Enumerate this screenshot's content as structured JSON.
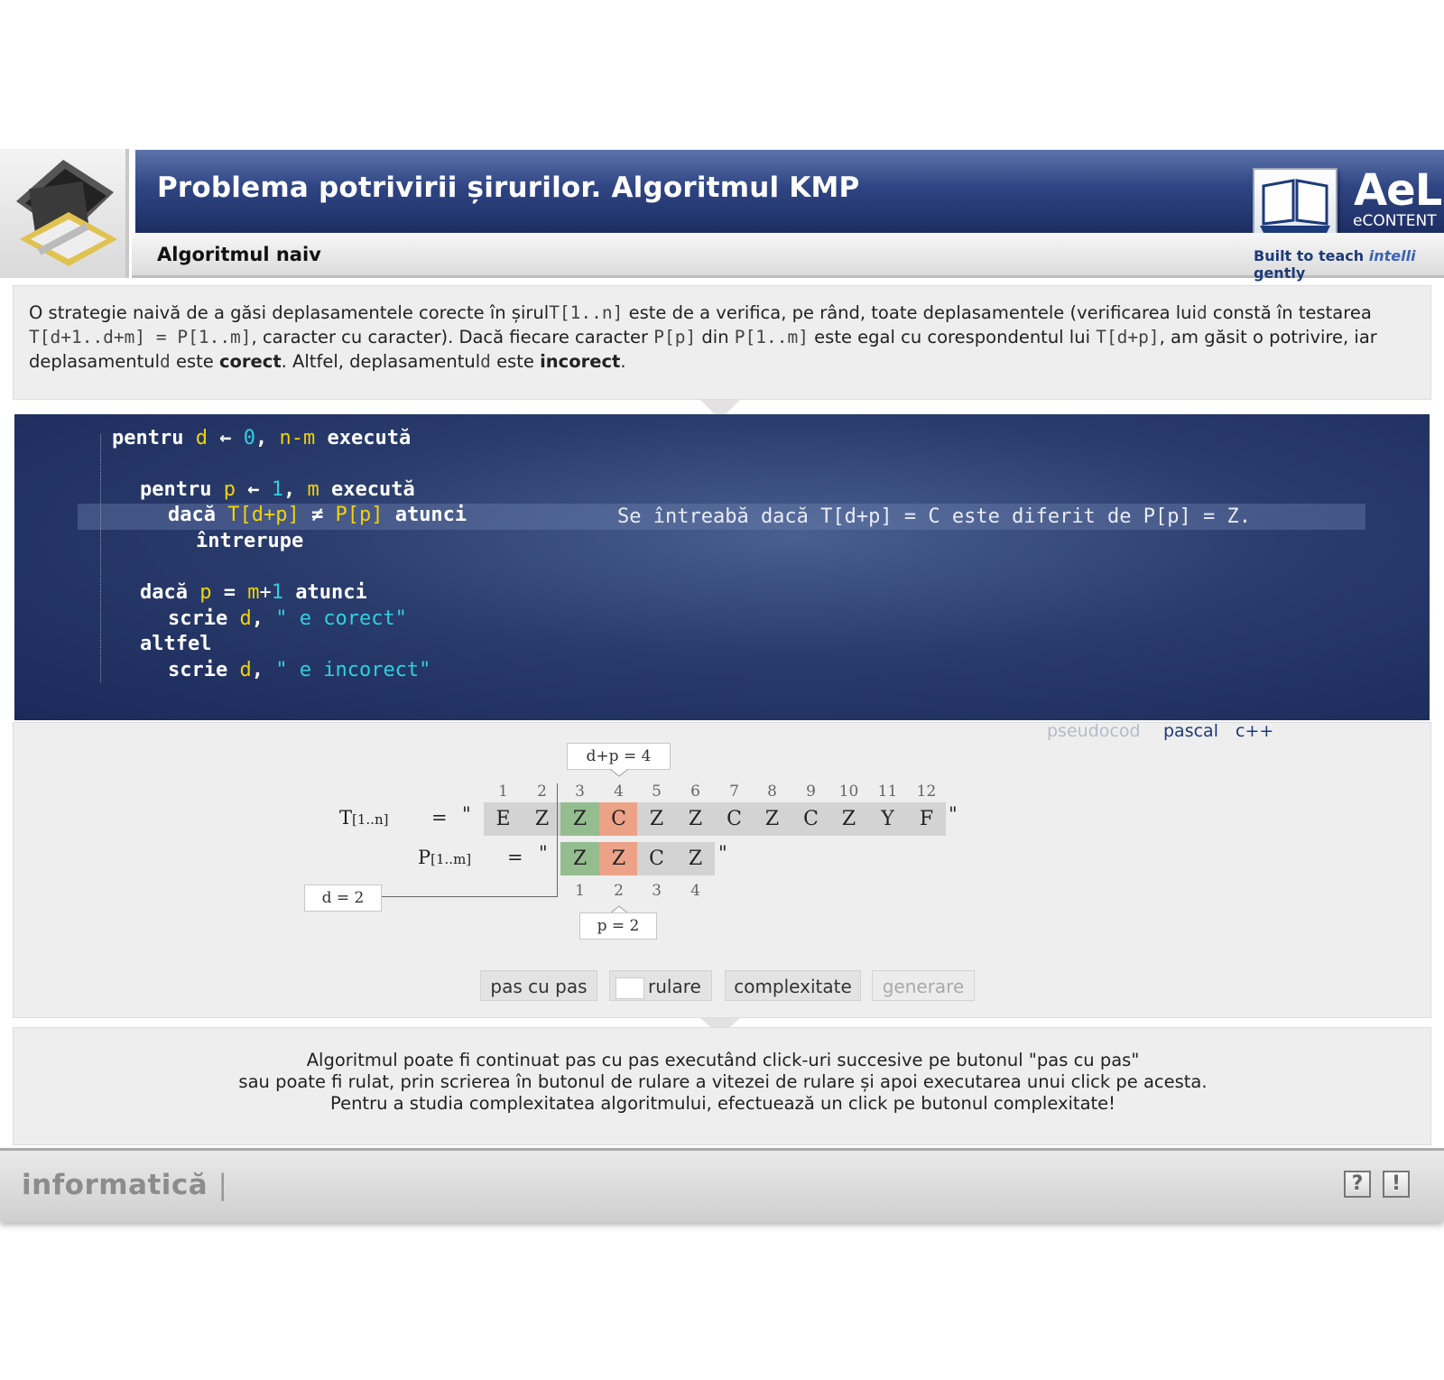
{
  "header": {
    "title": "Problema potrivirii șirurilor. Algoritmul KMP",
    "subtitle": "Algoritmul naiv",
    "brand": {
      "logo": "AeL",
      "econtent": "eCONTENT",
      "tagline_a": "Built to teach ",
      "tagline_b": "intelli",
      "tagline_c": " gently"
    }
  },
  "intro": {
    "t1": "O strategie naivă de a găsi deplasamentele corecte în șirul",
    "m1": "T[1..n]",
    "t2": " este de a verifica, pe rând, toate deplasamentele (verificarea lui",
    "m2": "d",
    "t3": " constă în testarea ",
    "m3": "T[d+1..d+m] = P[1..m]",
    "t4": ", caracter cu caracter). Dacă fiecare caracter ",
    "m4": "P[p]",
    "t5": " din ",
    "m5": "P[1..m]",
    "t6": " este egal cu corespondentul lui ",
    "m6": "T[d+p]",
    "t7": ", am găsit o potrivire, iar deplasamentul",
    "m7": "d",
    "t8": " este ",
    "b1": "corect",
    "t9": ". Altfel, deplasamentul",
    "m8": "d",
    "t10": " este ",
    "b2": "incorect",
    "t11": "."
  },
  "code": {
    "l1": {
      "kw": "pentru",
      "var": "d",
      "arrow": " ← ",
      "num": "0",
      "sep": ", ",
      "var2": "n-m",
      "kw2": " execută"
    },
    "l2": {
      "kw": "pentru",
      "var": "p",
      "arrow": " ← ",
      "num": "1",
      "sep": ", ",
      "var2": "m",
      "kw2": " execută"
    },
    "l3": {
      "kw": "dacă",
      "var": "T[d+p]",
      "op": " ≠ ",
      "var2": "P[p]",
      "kw2": " atunci"
    },
    "l4": {
      "kw": "întrerupe"
    },
    "l5": {
      "kw": "dacă",
      "var": "p",
      "op": " = ",
      "var2": "m",
      "op2": "+",
      "num": "1",
      "kw2": " atunci"
    },
    "l6": {
      "kw": "scrie",
      "var": "d",
      "sep": ", ",
      "str": "\" e corect\""
    },
    "l7": {
      "kw": "altfel"
    },
    "l8": {
      "kw": "scrie",
      "var": "d",
      "sep": ", ",
      "str": "\" e incorect\""
    },
    "note": "Se întreabă dacă T[d+p] = C este diferit de P[p] = Z."
  },
  "language_tabs": {
    "pseudocode": "pseudocod",
    "pascal": "pascal",
    "cpp": "c++",
    "active": "pseudocod"
  },
  "simulation": {
    "t_label": "T",
    "t_range": "[1..n]",
    "p_label": "P",
    "p_range": "[1..m]",
    "eq": "=",
    "quote": "\"",
    "text": [
      "E",
      "Z",
      "Z",
      "C",
      "Z",
      "Z",
      "C",
      "Z",
      "C",
      "Z",
      "Y",
      "F"
    ],
    "text_indices": [
      "1",
      "2",
      "3",
      "4",
      "5",
      "6",
      "7",
      "8",
      "9",
      "10",
      "11",
      "12"
    ],
    "pattern": [
      "Z",
      "Z",
      "C",
      "Z"
    ],
    "pattern_indices": [
      "1",
      "2",
      "3",
      "4"
    ],
    "shift_label": "d = 2",
    "pos_label": "d+p = 4",
    "p_label_box": "p = 2",
    "d": 2,
    "p": 2,
    "matched_color": "#94bd8f",
    "mismatch_color": "#eba287"
  },
  "buttons": {
    "step": "pas cu pas",
    "run": "rulare",
    "complexity": "complexitate",
    "generate": "generare"
  },
  "help": {
    "line1": "Algoritmul poate fi continuat pas cu pas executând click-uri succesive pe butonul \"pas cu pas\"",
    "line2": "sau poate fi rulat, prin scrierea în butonul de rulare a vitezei de rulare și apoi executarea unui click pe acesta.",
    "line3": "Pentru a studia complexitatea algoritmului, efectuează un click pe butonul complexitate!"
  },
  "footer": {
    "subject": "informatică",
    "separator": "|",
    "help_icon": "?",
    "info_icon": "!"
  }
}
